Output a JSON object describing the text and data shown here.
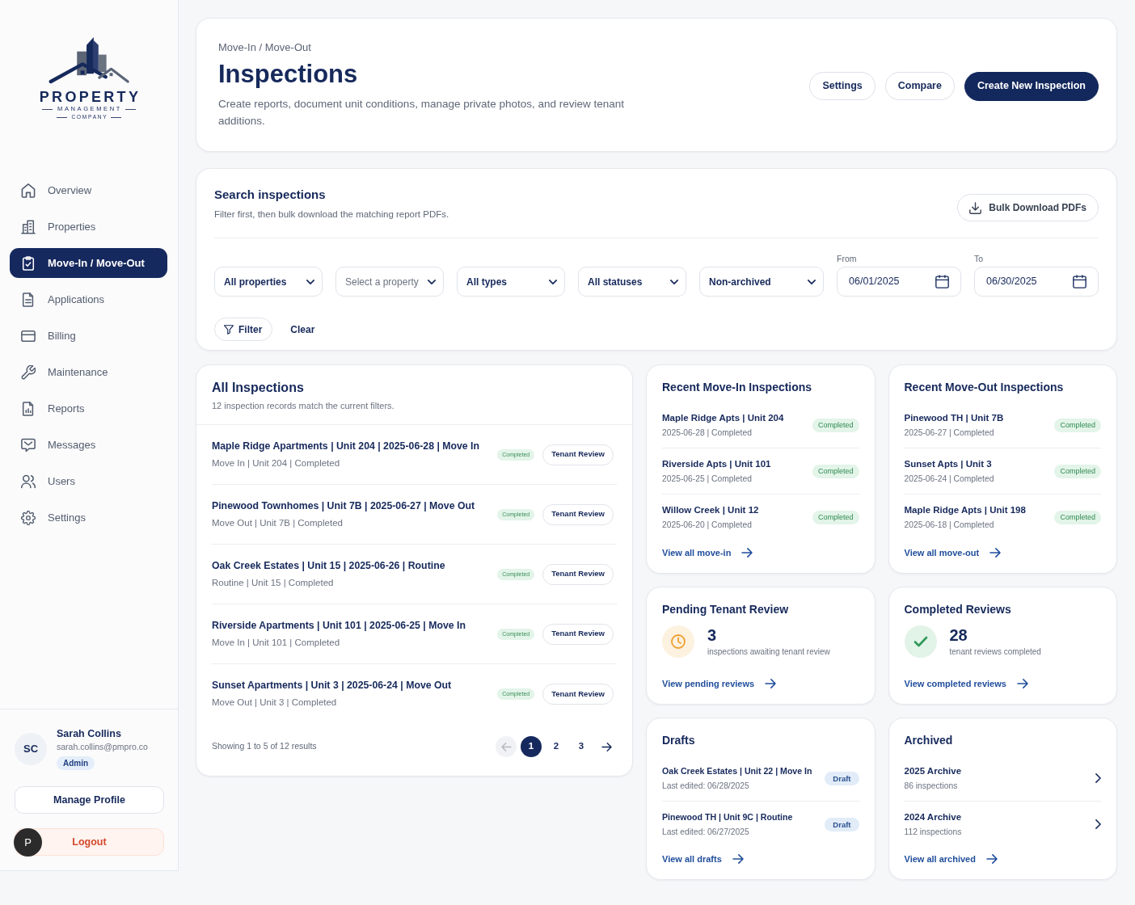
{
  "brand": {
    "name": "PROPERTY",
    "line2": "MANAGEMENT",
    "line3": "COMPANY"
  },
  "sidebar": {
    "items": [
      {
        "label": "Overview",
        "selected": false
      },
      {
        "label": "Properties",
        "selected": false
      },
      {
        "label": "Move-In / Move-Out",
        "selected": true
      },
      {
        "label": "Applications",
        "selected": false
      },
      {
        "label": "Billing",
        "selected": false
      },
      {
        "label": "Maintenance",
        "selected": false
      },
      {
        "label": "Reports",
        "selected": false
      },
      {
        "label": "Messages",
        "selected": false
      },
      {
        "label": "Users",
        "selected": false
      },
      {
        "label": "Settings",
        "selected": false
      }
    ]
  },
  "user": {
    "initials": "SC",
    "name": "Sarah Collins",
    "email": "sarah.collins@pmpro.co",
    "role": "Admin",
    "buttons": [
      {
        "label": "Manage Profile",
        "kind": "plain"
      },
      {
        "label": "Logout",
        "kind": "danger"
      }
    ]
  },
  "floating_avatar": {
    "initial": "P"
  },
  "header": {
    "breadcrumb": "Move-In / Move-Out",
    "title": "Inspections",
    "description": "Create reports, document unit conditions, manage private photos, and review tenant additions.",
    "buttons": [
      {
        "label": "Settings",
        "kind": "outline"
      },
      {
        "label": "Compare",
        "kind": "outline"
      },
      {
        "label": "Create New Inspection",
        "kind": "primary"
      }
    ]
  },
  "search": {
    "title": "Search inspections",
    "subtitle": "Filter first, then bulk download the matching report PDFs.",
    "bulk_button": "Bulk Download PDFs",
    "filters": [
      {
        "kind": "select",
        "value": "All properties"
      },
      {
        "kind": "select",
        "placeholder": "Select a property"
      },
      {
        "kind": "select",
        "value": "All types"
      },
      {
        "kind": "select",
        "value": "All statuses"
      },
      {
        "kind": "select",
        "value": "Non-archived"
      },
      {
        "kind": "date",
        "label": "From",
        "value": "06/01/2025"
      },
      {
        "kind": "date",
        "label": "To",
        "value": "06/30/2025"
      }
    ],
    "filter_button": "Filter",
    "clear_button": "Clear"
  },
  "all_inspections": {
    "title": "All Inspections",
    "subtitle": "12 inspection records match the current filters.",
    "rows": [
      {
        "title": "Maple Ridge Apartments | Unit 204 | 2025-06-28 | Move In",
        "meta": "Move In | Unit 204 | Completed",
        "status": "Completed",
        "action": "Tenant Review"
      },
      {
        "title": "Pinewood Townhomes | Unit 7B | 2025-06-27 | Move Out",
        "meta": "Move Out | Unit 7B | Completed",
        "status": "Completed",
        "action": "Tenant Review"
      },
      {
        "title": "Oak Creek Estates | Unit 15 | 2025-06-26 | Routine",
        "meta": "Routine | Unit 15 | Completed",
        "status": "Completed",
        "action": "Tenant Review"
      },
      {
        "title": "Riverside Apartments | Unit 101 | 2025-06-25 | Move In",
        "meta": "Move In | Unit 101 | Completed",
        "status": "Completed",
        "action": "Tenant Review"
      },
      {
        "title": "Sunset Apartments | Unit 3 | 2025-06-24 | Move Out",
        "meta": "Move Out | Unit 3 | Completed",
        "status": "Completed",
        "action": "Tenant Review"
      }
    ],
    "pagination": {
      "summary": "Showing 1 to 5 of 12 results",
      "prev": {
        "disabled": true
      },
      "pages": [
        {
          "label": "1",
          "selected": true
        },
        {
          "label": "2",
          "selected": false
        },
        {
          "label": "3",
          "selected": false
        }
      ],
      "next": {
        "disabled": false
      }
    }
  },
  "panels": [
    {
      "kind": "recent",
      "title": "Recent Move-In Inspections",
      "items": [
        {
          "name": "Maple Ridge Apts | Unit 204",
          "meta": "2025-06-28 | Completed",
          "badge": "Completed"
        },
        {
          "name": "Riverside Apts | Unit 101",
          "meta": "2025-06-25 | Completed",
          "badge": "Completed"
        },
        {
          "name": "Willow Creek | Unit 12",
          "meta": "2025-06-20 | Completed",
          "badge": "Completed"
        }
      ],
      "link": "View all move-in"
    },
    {
      "kind": "recent",
      "title": "Recent Move-Out Inspections",
      "items": [
        {
          "name": "Pinewood TH | Unit 7B",
          "meta": "2025-06-27 | Completed",
          "badge": "Completed"
        },
        {
          "name": "Sunset Apts | Unit 3",
          "meta": "2025-06-24 | Completed",
          "badge": "Completed"
        },
        {
          "name": "Maple Ridge Apts | Unit 198",
          "meta": "2025-06-18 | Completed",
          "badge": "Completed"
        }
      ],
      "link": "View all move-out"
    },
    {
      "kind": "pending",
      "title": "Pending Tenant Review",
      "count": "3",
      "caption": "inspections awaiting tenant review",
      "link": "View pending reviews"
    },
    {
      "kind": "reviewed",
      "title": "Completed Reviews",
      "count": "28",
      "caption": "tenant reviews completed",
      "link": "View completed reviews"
    },
    {
      "kind": "drafts",
      "title": "Drafts",
      "items": [
        {
          "name": "Oak Creek Estates | Unit 22 | Move In",
          "meta": "Last edited: 06/28/2025",
          "badge": "Draft"
        },
        {
          "name": "Pinewood TH | Unit 9C | Routine",
          "meta": "Last edited: 06/27/2025",
          "badge": "Draft"
        }
      ],
      "link": "View all drafts"
    },
    {
      "kind": "archive",
      "title": "Archived",
      "items": [
        {
          "name": "2025 Archive",
          "meta": "86 inspections"
        },
        {
          "name": "2024 Archive",
          "meta": "112 inspections"
        }
      ],
      "link": "View all archived"
    }
  ]
}
